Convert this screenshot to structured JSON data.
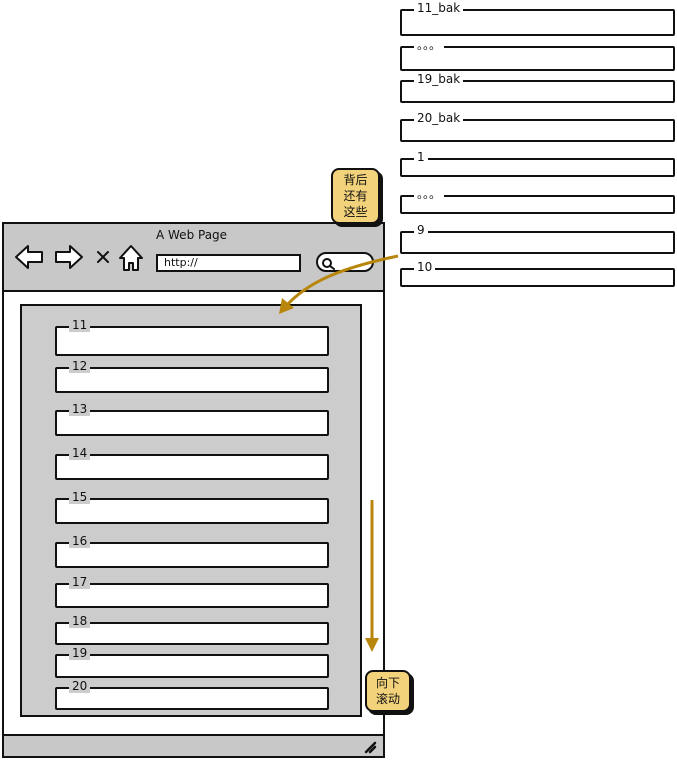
{
  "side_list": {
    "items": [
      "11_bak",
      "。。。",
      "19_bak",
      "20_bak",
      "1",
      "。。。",
      "9",
      "10"
    ]
  },
  "browser": {
    "title": "A Web Page",
    "url": "http://",
    "nav": {
      "back": "back-arrow-icon",
      "forward": "forward-arrow-icon",
      "stop": "close-icon",
      "home": "home-icon",
      "search": "search-icon",
      "resize": "resize-grip-icon"
    },
    "list_items": [
      "11",
      "12",
      "13",
      "14",
      "15",
      "16",
      "17",
      "18",
      "19",
      "20"
    ]
  },
  "notes": {
    "behind": {
      "line1": "背后",
      "line2": "还有",
      "line3": "这些"
    },
    "scroll": {
      "line1": "向下",
      "line2": "滚动"
    }
  },
  "colors": {
    "toolbar": "#c8c8c8",
    "panel": "#cccccc",
    "note": "#f2d27a",
    "arrow": "#b8860b",
    "ink": "#111111"
  }
}
